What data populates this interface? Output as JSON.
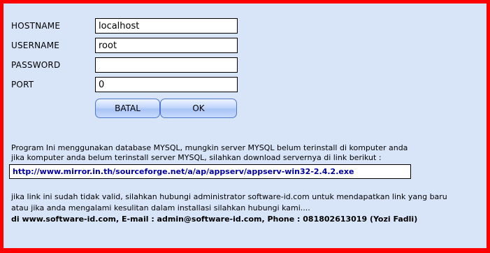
{
  "form": {
    "hostname_label": "HOSTNAME",
    "hostname_value": "localhost",
    "username_label": "USERNAME",
    "username_value": "root",
    "password_label": "PASSWORD",
    "password_value": "",
    "port_label": "PORT",
    "port_value": "0",
    "cancel_label": "BATAL",
    "ok_label": "OK"
  },
  "info": {
    "line1": "Program Ini menggunakan database MYSQL, mungkin server MYSQL belum terinstall di komputer anda",
    "line2": "jika komputer anda belum terinstall server MYSQL, silahkan download servernya di link berikut :",
    "download_link": "http://www.mirror.in.th/sourceforge.net/a/ap/appserv/appserv-win32-2.4.2.exe",
    "line3": "jika link ini sudah tidak valid, silahkan hubungi administrator software-id.com untuk mendapatkan link yang baru",
    "line4": "atau jika anda mengalami kesulitan dalam installasi silahkan hubungi kami....",
    "contact": "di www.software-id.com, E-mail : admin@software-id.com, Phone : 081802613019 (Yozi Fadli)"
  },
  "colors": {
    "border": "#ff0000",
    "panel": "#d8e5f8",
    "link": "#0000a0"
  }
}
